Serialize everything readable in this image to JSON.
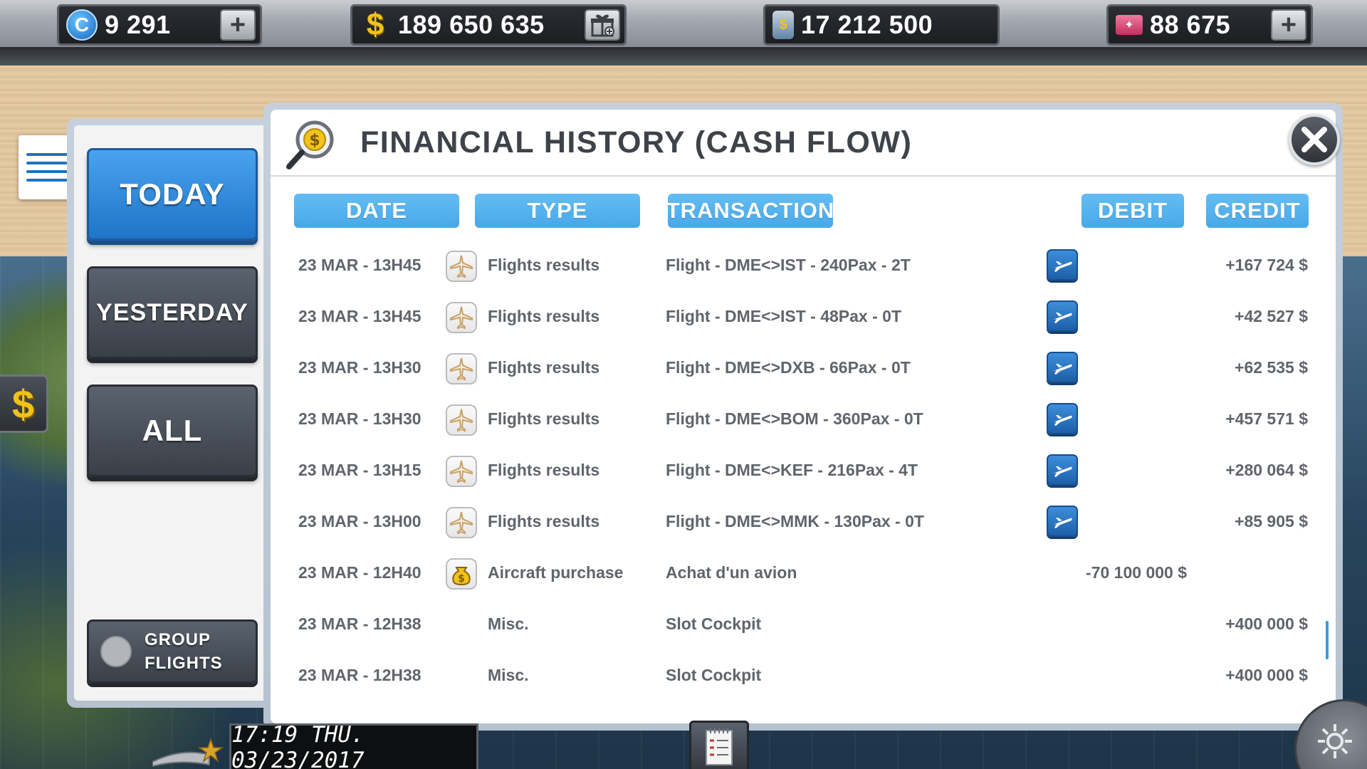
{
  "topbar": {
    "coins": {
      "value": "9 291",
      "icon": "coin-icon"
    },
    "cash": {
      "value": "189 650 635",
      "icon": "dollar-icon"
    },
    "research": {
      "value": "17 212 500",
      "icon": "flask-icon"
    },
    "tickets": {
      "value": "88 675",
      "icon": "ticket-icon"
    }
  },
  "sidebar": {
    "filters": [
      {
        "label": "TODAY",
        "active": true
      },
      {
        "label": "YESTERDAY",
        "active": false
      },
      {
        "label": "ALL",
        "active": false
      }
    ],
    "group_flights": {
      "line1": "GROUP",
      "line2": "FLIGHTS",
      "enabled": false
    }
  },
  "panel": {
    "title": "FINANCIAL HISTORY (CASH FLOW)"
  },
  "table": {
    "headers": {
      "date": "DATE",
      "type": "TYPE",
      "transaction": "TRANSACTION",
      "debit": "DEBIT",
      "credit": "CREDIT"
    },
    "rows": [
      {
        "date": "23 MAR - 13H45",
        "type": "Flights results",
        "type_icon": "plane-icon",
        "transaction": "Flight - DME<>IST - 240Pax - 2T",
        "debit": "",
        "credit": "+167 724 $",
        "has_detail": true
      },
      {
        "date": "23 MAR - 13H45",
        "type": "Flights results",
        "type_icon": "plane-icon",
        "transaction": "Flight - DME<>IST - 48Pax - 0T",
        "debit": "",
        "credit": "+42 527 $",
        "has_detail": true
      },
      {
        "date": "23 MAR - 13H30",
        "type": "Flights results",
        "type_icon": "plane-icon",
        "transaction": "Flight - DME<>DXB - 66Pax - 0T",
        "debit": "",
        "credit": "+62 535 $",
        "has_detail": true
      },
      {
        "date": "23 MAR - 13H30",
        "type": "Flights results",
        "type_icon": "plane-icon",
        "transaction": "Flight - DME<>BOM - 360Pax - 0T",
        "debit": "",
        "credit": "+457 571 $",
        "has_detail": true
      },
      {
        "date": "23 MAR - 13H15",
        "type": "Flights results",
        "type_icon": "plane-icon",
        "transaction": "Flight - DME<>KEF - 216Pax - 4T",
        "debit": "",
        "credit": "+280 064 $",
        "has_detail": true
      },
      {
        "date": "23 MAR - 13H00",
        "type": "Flights results",
        "type_icon": "plane-icon",
        "transaction": "Flight - DME<>MMK - 130Pax - 0T",
        "debit": "",
        "credit": "+85 905 $",
        "has_detail": true
      },
      {
        "date": "23 MAR - 12H40",
        "type": "Aircraft purchase",
        "type_icon": "money-bag-icon",
        "transaction": "Achat d'un avion",
        "debit": "-70 100 000 $",
        "credit": "",
        "has_detail": false
      },
      {
        "date": "23 MAR - 12H38",
        "type": "Misc.",
        "type_icon": "",
        "transaction": "Slot Cockpit",
        "debit": "",
        "credit": "+400 000 $",
        "has_detail": false
      },
      {
        "date": "23 MAR - 12H38",
        "type": "Misc.",
        "type_icon": "",
        "transaction": "Slot Cockpit",
        "debit": "",
        "credit": "+400 000 $",
        "has_detail": false
      }
    ]
  },
  "bottombar": {
    "clock": "17:19 THU. 03/23/2017"
  }
}
